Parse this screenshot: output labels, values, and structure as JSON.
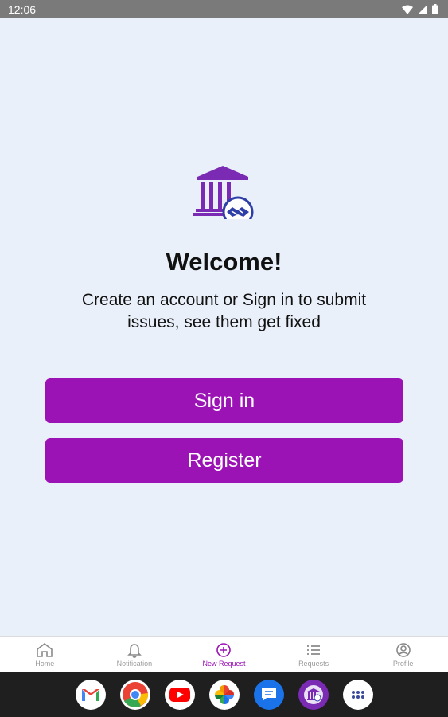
{
  "status_bar": {
    "time": "12:06"
  },
  "welcome": {
    "title": "Welcome!",
    "subtitle": "Create an account or Sign in to submit issues, see them get fixed"
  },
  "buttons": {
    "sign_in": "Sign in",
    "register": "Register"
  },
  "bottom_nav": {
    "active": "New Request",
    "items": [
      {
        "label": "Home",
        "icon": "home-icon"
      },
      {
        "label": "Notification",
        "icon": "bell-icon"
      },
      {
        "label": "New Request",
        "icon": "plus-circle-icon"
      },
      {
        "label": "Requests",
        "icon": "list-icon"
      },
      {
        "label": "Profile",
        "icon": "profile-icon"
      }
    ]
  },
  "dock_apps": [
    "gmail-icon",
    "chrome-icon",
    "youtube-icon",
    "photos-icon",
    "messages-icon",
    "civic-app-icon",
    "app-drawer-icon"
  ],
  "colors": {
    "accent": "#9b12b5",
    "background": "#e9f0f9",
    "logo_primary": "#7b2ab3",
    "logo_secondary": "#2f3fa8"
  }
}
